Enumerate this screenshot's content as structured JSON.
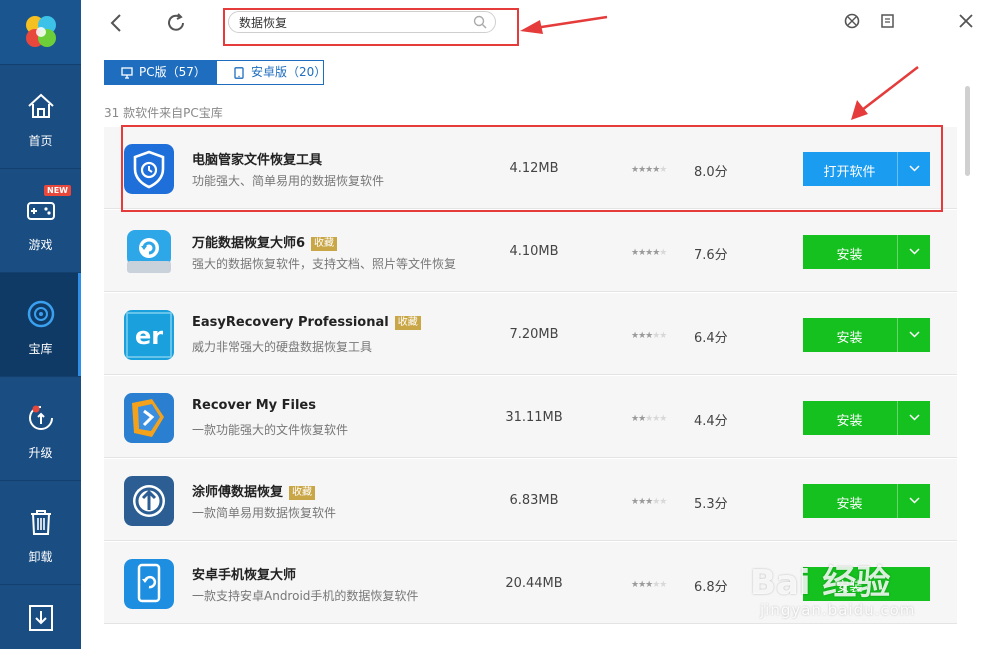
{
  "sidebar": {
    "items": [
      {
        "label": "首页",
        "icon": "home-icon"
      },
      {
        "label": "游戏",
        "icon": "gamepad-icon",
        "badge": "NEW"
      },
      {
        "label": "宝库",
        "icon": "disc-icon",
        "active": true
      },
      {
        "label": "升级",
        "icon": "upgrade-icon"
      },
      {
        "label": "卸载",
        "icon": "trash-icon"
      },
      {
        "label": "",
        "icon": "download-icon"
      }
    ]
  },
  "search": {
    "value": "数据恢复"
  },
  "tabs": [
    {
      "label": "PC版（57）",
      "icon": "monitor-icon",
      "selected": true
    },
    {
      "label": "安卓版（20）",
      "icon": "tablet-icon",
      "selected": false
    }
  ],
  "count_text": "31 款软件来自PC宝库",
  "apps": [
    {
      "name": "电脑管家文件恢复工具",
      "tag": "",
      "desc": "功能强大、简单易用的数据恢复软件",
      "size": "4.12MB",
      "rating": 4,
      "score": "8.0分",
      "action": "打开软件",
      "action_color": "blue"
    },
    {
      "name": "万能数据恢复大师6",
      "tag": "收藏",
      "desc": "强大的数据恢复软件，支持文档、照片等文件恢复",
      "size": "4.10MB",
      "rating": 3.5,
      "score": "7.6分",
      "action": "安装",
      "action_color": "green"
    },
    {
      "name": "EasyRecovery Professional",
      "tag": "收藏",
      "desc": "威力非常强大的硬盘数据恢复工具",
      "size": "7.20MB",
      "rating": 3,
      "score": "6.4分",
      "action": "安装",
      "action_color": "green"
    },
    {
      "name": "Recover My Files",
      "tag": "",
      "desc": "一款功能强大的文件恢复软件",
      "size": "31.11MB",
      "rating": 2,
      "score": "4.4分",
      "action": "安装",
      "action_color": "green"
    },
    {
      "name": "涂师傅数据恢复",
      "tag": "收藏",
      "desc": "一款简单易用数据恢复软件",
      "size": "6.83MB",
      "rating": 2.5,
      "score": "5.3分",
      "action": "安装",
      "action_color": "green"
    },
    {
      "name": "安卓手机恢复大师",
      "tag": "",
      "desc": "一款支持安卓Android手机的数据恢复软件",
      "size": "20.44MB",
      "rating": 3,
      "score": "6.8分",
      "action": "安装",
      "action_color": "green"
    }
  ],
  "colors": {
    "sidebar": "#1a4d82",
    "accent_blue": "#1a9cf0",
    "install_green": "#14c11e",
    "highlight_red": "#e53b3b"
  },
  "watermark": {
    "text": "Bai 经验",
    "url": "jingyan.baidu.com"
  }
}
